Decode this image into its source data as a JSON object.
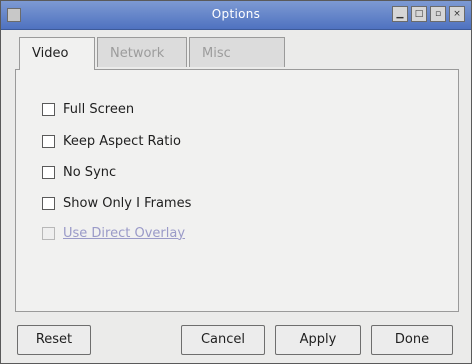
{
  "window": {
    "title": "Options"
  },
  "tabs": [
    {
      "label": "Video",
      "active": true
    },
    {
      "label": "Network",
      "active": false
    },
    {
      "label": "Misc",
      "active": false
    }
  ],
  "video": {
    "options": [
      {
        "label": "Full Screen",
        "checked": false,
        "enabled": true
      },
      {
        "label": "Keep Aspect Ratio",
        "checked": false,
        "enabled": true
      },
      {
        "label": "No Sync",
        "checked": false,
        "enabled": true
      },
      {
        "label": "Show Only I Frames",
        "checked": false,
        "enabled": true
      },
      {
        "label": "Use Direct Overlay",
        "checked": false,
        "enabled": false
      }
    ]
  },
  "buttons": {
    "reset": "Reset",
    "cancel": "Cancel",
    "apply": "Apply",
    "done": "Done"
  },
  "colors": {
    "titlebar": "#4f72c0",
    "disabled_text": "#9a9ac8"
  }
}
